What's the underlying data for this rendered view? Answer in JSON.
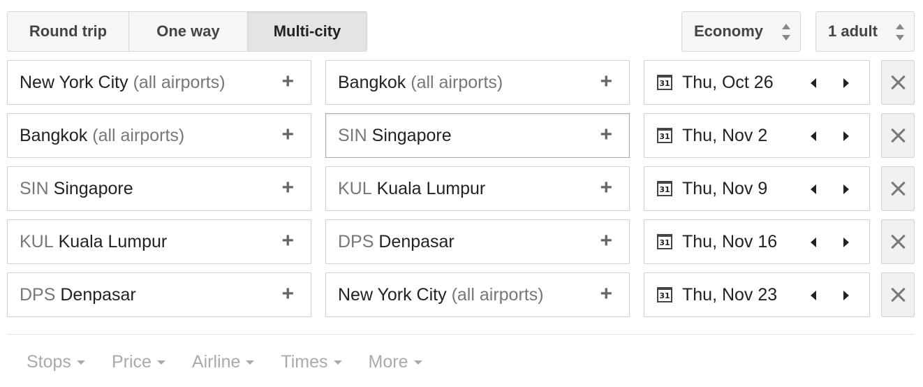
{
  "trip_types": [
    {
      "label": "Round trip",
      "active": false
    },
    {
      "label": "One way",
      "active": false
    },
    {
      "label": "Multi-city",
      "active": true
    }
  ],
  "cabin": {
    "label": "Economy"
  },
  "passengers": {
    "label": "1 adult"
  },
  "legs": [
    {
      "from_code": "",
      "from_name": "New York City",
      "from_suffix": "(all airports)",
      "to_code": "",
      "to_name": "Bangkok",
      "to_suffix": "(all airports)",
      "date": "Thu, Oct 26"
    },
    {
      "from_code": "",
      "from_name": "Bangkok",
      "from_suffix": "(all airports)",
      "to_code": "SIN",
      "to_name": "Singapore",
      "to_suffix": "",
      "date": "Thu, Nov 2"
    },
    {
      "from_code": "SIN",
      "from_name": "Singapore",
      "from_suffix": "",
      "to_code": "KUL",
      "to_name": "Kuala Lumpur",
      "to_suffix": "",
      "date": "Thu, Nov 9"
    },
    {
      "from_code": "KUL",
      "from_name": "Kuala Lumpur",
      "from_suffix": "",
      "to_code": "DPS",
      "to_name": "Denpasar",
      "to_suffix": "",
      "date": "Thu, Nov 16"
    },
    {
      "from_code": "DPS",
      "from_name": "Denpasar",
      "from_suffix": "",
      "to_code": "",
      "to_name": "New York City",
      "to_suffix": "(all airports)",
      "date": "Thu, Nov 23"
    }
  ],
  "calendar_icon_text": "31",
  "add_symbol": "+",
  "filters": [
    {
      "label": "Stops"
    },
    {
      "label": "Price"
    },
    {
      "label": "Airline"
    },
    {
      "label": "Times"
    },
    {
      "label": "More"
    }
  ],
  "colors": {
    "accent_gray": "#777777",
    "filter_gray": "#aaaaaa",
    "button_bg": "#f6f6f6"
  }
}
